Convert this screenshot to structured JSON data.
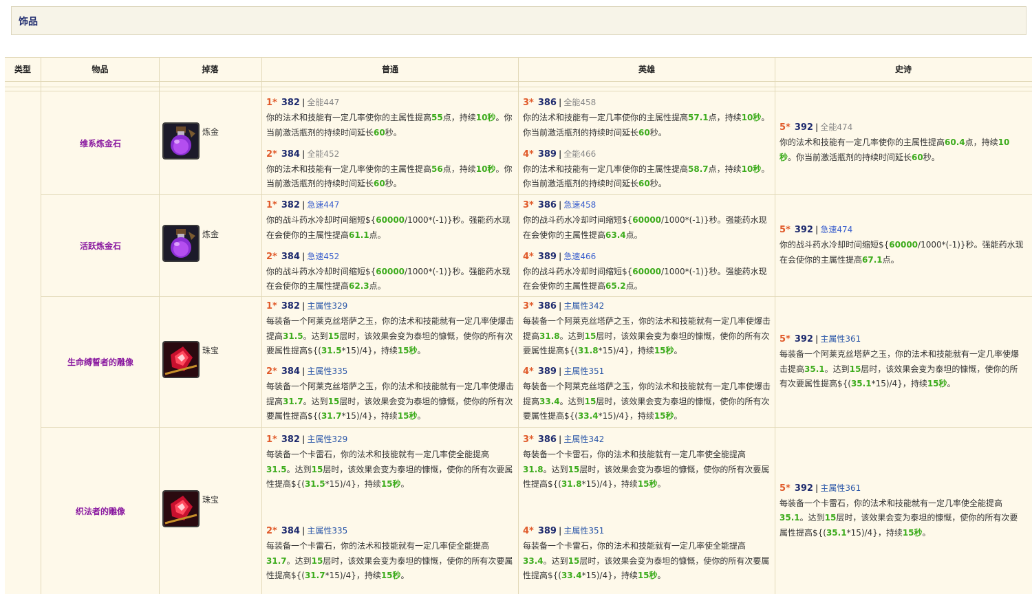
{
  "section": {
    "title": "饰品"
  },
  "headers": [
    "类型",
    "物品",
    "掉落",
    "普通",
    "英雄",
    "史诗"
  ],
  "rows": [
    {
      "name": "维系炼金石",
      "drop": "炼金",
      "icon": "alchemist-stone-potion-icon",
      "normal": [
        {
          "star": "1*",
          "ilvl": "382",
          "stat": "全能447",
          "d": [
            "你的法术和技能有一定几率使你的主属性提高",
            "55",
            "点，持续",
            "10秒",
            "。你当前激活瓶剂的持续时间延长",
            "60",
            "秒。"
          ]
        },
        {
          "star": "2*",
          "ilvl": "384",
          "stat": "全能452",
          "d": [
            "你的法术和技能有一定几率使你的主属性提高",
            "56",
            "点，持续",
            "10秒",
            "。你当前激活瓶剂的持续时间延长",
            "60",
            "秒。"
          ]
        }
      ],
      "heroic": [
        {
          "star": "3*",
          "ilvl": "386",
          "stat": "全能458",
          "d": [
            "你的法术和技能有一定几率使你的主属性提高",
            "57.1",
            "点，持续",
            "10秒",
            "。你当前激活瓶剂的持续时间延长",
            "60",
            "秒。"
          ]
        },
        {
          "star": "4*",
          "ilvl": "389",
          "stat": "全能466",
          "d": [
            "你的法术和技能有一定几率使你的主属性提高",
            "58.7",
            "点，持续",
            "10秒",
            "。你当前激活瓶剂的持续时间延长",
            "60",
            "秒。"
          ]
        }
      ],
      "epic": [
        {
          "star": "5*",
          "ilvl": "392",
          "stat": "全能474",
          "d": [
            "你的法术和技能有一定几率使你的主属性提高",
            "60.4",
            "点，持续",
            "10秒",
            "。你当前激活瓶剂的持续时间延长",
            "60",
            "秒。"
          ]
        }
      ]
    },
    {
      "name": "活跃炼金石",
      "drop": "炼金",
      "icon": "alchemist-stone-potion-icon",
      "normal": [
        {
          "star": "1*",
          "ilvl": "382",
          "stat": "急速447",
          "d": [
            "你的战斗药水冷却时间缩短${",
            "60000",
            "/1000*(-1)}秒。强能药水现在会使你的主属性提高",
            "61.1",
            "点。"
          ]
        },
        {
          "star": "2*",
          "ilvl": "384",
          "stat": "急速452",
          "d": [
            "你的战斗药水冷却时间缩短${",
            "60000",
            "/1000*(-1)}秒。强能药水现在会使你的主属性提高",
            "62.3",
            "点。"
          ]
        }
      ],
      "heroic": [
        {
          "star": "3*",
          "ilvl": "386",
          "stat": "急速458",
          "d": [
            "你的战斗药水冷却时间缩短${",
            "60000",
            "/1000*(-1)}秒。强能药水现在会使你的主属性提高",
            "63.4",
            "点。"
          ]
        },
        {
          "star": "4*",
          "ilvl": "389",
          "stat": "急速466",
          "d": [
            "你的战斗药水冷却时间缩短${",
            "60000",
            "/1000*(-1)}秒。强能药水现在会使你的主属性提高",
            "65.2",
            "点。"
          ]
        }
      ],
      "epic": [
        {
          "star": "5*",
          "ilvl": "392",
          "stat": "急速474",
          "d": [
            "你的战斗药水冷却时间缩短${",
            "60000",
            "/1000*(-1)}秒。强能药水现在会使你的主属性提高",
            "67.1",
            "点。"
          ]
        }
      ]
    },
    {
      "name": "生命缚誓者的雕像",
      "drop": "珠宝",
      "icon": "ruby-figurine-icon",
      "normal": [
        {
          "star": "1*",
          "ilvl": "382",
          "stat": "主属性329",
          "d": [
            "每装备一个阿莱克丝塔萨之玉，你的法术和技能就有一定几率使爆击提高",
            "31.5",
            "。达到",
            "15",
            "层时，该效果会变为泰坦的慷慨，使你的所有次要属性提高${(",
            "31.5",
            "*15)/4}，持续",
            "15秒",
            "。"
          ]
        },
        {
          "star": "2*",
          "ilvl": "384",
          "stat": "主属性335",
          "d": [
            "每装备一个阿莱克丝塔萨之玉，你的法术和技能就有一定几率使爆击提高",
            "31.7",
            "。达到",
            "15",
            "层时，该效果会变为泰坦的慷慨，使你的所有次要属性提高${(",
            "31.7",
            "*15)/4}，持续",
            "15秒",
            "。"
          ]
        }
      ],
      "heroic": [
        {
          "star": "3*",
          "ilvl": "386",
          "stat": "主属性342",
          "d": [
            "每装备一个阿莱克丝塔萨之玉，你的法术和技能就有一定几率使爆击提高",
            "31.8",
            "。达到",
            "15",
            "层时，该效果会变为泰坦的慷慨，使你的所有次要属性提高${(",
            "31.8",
            "*15)/4}，持续",
            "15秒",
            "。"
          ]
        },
        {
          "star": "4*",
          "ilvl": "389",
          "stat": "主属性351",
          "d": [
            "每装备一个阿莱克丝塔萨之玉，你的法术和技能就有一定几率使爆击提高",
            "33.4",
            "。达到",
            "15",
            "层时，该效果会变为泰坦的慷慨，使你的所有次要属性提高${(",
            "33.4",
            "*15)/4}，持续",
            "15秒",
            "。"
          ]
        }
      ],
      "epic": [
        {
          "star": "5*",
          "ilvl": "392",
          "stat": "主属性361",
          "d": [
            "每装备一个阿莱克丝塔萨之玉，你的法术和技能就有一定几率使爆击提高",
            "35.1",
            "。达到",
            "15",
            "层时，该效果会变为泰坦的慷慨，使你的所有次要属性提高${(",
            "35.1",
            "*15)/4}，持续",
            "15秒",
            "。"
          ]
        }
      ]
    },
    {
      "name": "织法者的雕像",
      "drop": "珠宝",
      "icon": "ruby-figurine-icon",
      "normal": [
        {
          "star": "1*",
          "ilvl": "382",
          "stat": "主属性329",
          "d": [
            "每装备一个卡雷石，你的法术和技能就有一定几率使全能提高",
            "31.5",
            "。达到",
            "15",
            "层时，该效果会变为泰坦的慷慨，使你的所有次要属性提高${(",
            "31.5",
            "*15)/4}，持续",
            "15秒",
            "。"
          ]
        },
        {
          "star": "2*",
          "ilvl": "384",
          "stat": "主属性335",
          "d": [
            "每装备一个卡雷石，你的法术和技能就有一定几率使全能提高",
            "31.7",
            "。达到",
            "15",
            "层时，该效果会变为泰坦的慷慨，使你的所有次要属性提高${(",
            "31.7",
            "*15)/4}，持续",
            "15秒",
            "。"
          ]
        }
      ],
      "heroic": [
        {
          "star": "3*",
          "ilvl": "386",
          "stat": "主属性342",
          "d": [
            "每装备一个卡雷石，你的法术和技能就有一定几率使全能提高",
            "31.8",
            "。达到",
            "15",
            "层时，该效果会变为泰坦的慷慨，使你的所有次要属性提高${(",
            "31.8",
            "*15)/4}，持续",
            "15秒",
            "。"
          ]
        },
        {
          "star": "4*",
          "ilvl": "389",
          "stat": "主属性351",
          "d": [
            "每装备一个卡雷石，你的法术和技能就有一定几率使全能提高",
            "33.4",
            "。达到",
            "15",
            "层时，该效果会变为泰坦的慷慨，使你的所有次要属性提高${(",
            "33.4",
            "*15)/4}，持续",
            "15秒",
            "。"
          ]
        }
      ],
      "epic": [
        {
          "star": "5*",
          "ilvl": "392",
          "stat": "主属性361",
          "d": [
            "每装备一个卡雷石，你的法术和技能就有一定几率使全能提高",
            "35.1",
            "。达到",
            "15",
            "层时，该效果会变为泰坦的慷慨，使你的所有次要属性提高${(",
            "35.1",
            "*15)/4}，持续",
            "15秒",
            "。"
          ]
        }
      ]
    }
  ]
}
